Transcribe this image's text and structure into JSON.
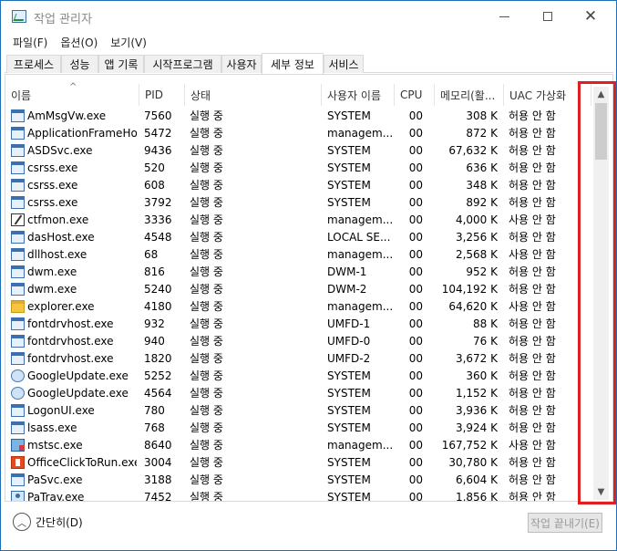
{
  "window": {
    "title": "작업 관리자",
    "icon": "task-manager-icon"
  },
  "menu": [
    "파일(F)",
    "옵션(O)",
    "보기(V)"
  ],
  "tabs": [
    {
      "label": "프로세스"
    },
    {
      "label": "성능"
    },
    {
      "label": "앱 기록"
    },
    {
      "label": "시작프로그램"
    },
    {
      "label": "사용자"
    },
    {
      "label": "세부 정보",
      "active": true
    },
    {
      "label": "서비스"
    }
  ],
  "columns": {
    "name": "이름",
    "pid": "PID",
    "status": "상태",
    "user": "사용자 이름",
    "cpu": "CPU",
    "memory": "메모리(활...",
    "uac": "UAC 가상화"
  },
  "processes": [
    {
      "name": "AmMsgVw.exe",
      "pid": "7560",
      "status": "실행 중",
      "user": "SYSTEM",
      "cpu": "00",
      "memory": "308 K",
      "uac": "허용 안 함",
      "icon": "app-icon"
    },
    {
      "name": "ApplicationFrameHo...",
      "pid": "5472",
      "status": "실행 중",
      "user": "managem...",
      "cpu": "00",
      "memory": "872 K",
      "uac": "허용 안 함",
      "icon": "window-icon"
    },
    {
      "name": "ASDSvc.exe",
      "pid": "9436",
      "status": "실행 중",
      "user": "SYSTEM",
      "cpu": "00",
      "memory": "67,632 K",
      "uac": "허용 안 함",
      "icon": "window-icon"
    },
    {
      "name": "csrss.exe",
      "pid": "520",
      "status": "실행 중",
      "user": "SYSTEM",
      "cpu": "00",
      "memory": "636 K",
      "uac": "허용 안 함",
      "icon": "window-icon"
    },
    {
      "name": "csrss.exe",
      "pid": "608",
      "status": "실행 중",
      "user": "SYSTEM",
      "cpu": "00",
      "memory": "348 K",
      "uac": "허용 안 함",
      "icon": "window-icon"
    },
    {
      "name": "csrss.exe",
      "pid": "3792",
      "status": "실행 중",
      "user": "SYSTEM",
      "cpu": "00",
      "memory": "892 K",
      "uac": "허용 안 함",
      "icon": "window-icon"
    },
    {
      "name": "ctfmon.exe",
      "pid": "3336",
      "status": "실행 중",
      "user": "managem...",
      "cpu": "00",
      "memory": "4,000 K",
      "uac": "사용 안 함",
      "icon": "pen-icon"
    },
    {
      "name": "dasHost.exe",
      "pid": "4548",
      "status": "실행 중",
      "user": "LOCAL SE...",
      "cpu": "00",
      "memory": "3,256 K",
      "uac": "허용 안 함",
      "icon": "window-icon"
    },
    {
      "name": "dllhost.exe",
      "pid": "68",
      "status": "실행 중",
      "user": "managem...",
      "cpu": "00",
      "memory": "2,568 K",
      "uac": "사용 안 함",
      "icon": "window-icon"
    },
    {
      "name": "dwm.exe",
      "pid": "816",
      "status": "실행 중",
      "user": "DWM-1",
      "cpu": "00",
      "memory": "952 K",
      "uac": "허용 안 함",
      "icon": "window-icon"
    },
    {
      "name": "dwm.exe",
      "pid": "5240",
      "status": "실행 중",
      "user": "DWM-2",
      "cpu": "00",
      "memory": "104,192 K",
      "uac": "허용 안 함",
      "icon": "window-icon"
    },
    {
      "name": "explorer.exe",
      "pid": "4180",
      "status": "실행 중",
      "user": "managem...",
      "cpu": "00",
      "memory": "64,620 K",
      "uac": "사용 안 함",
      "icon": "folder-icon"
    },
    {
      "name": "fontdrvhost.exe",
      "pid": "932",
      "status": "실행 중",
      "user": "UMFD-1",
      "cpu": "00",
      "memory": "88 K",
      "uac": "허용 안 함",
      "icon": "window-icon"
    },
    {
      "name": "fontdrvhost.exe",
      "pid": "940",
      "status": "실행 중",
      "user": "UMFD-0",
      "cpu": "00",
      "memory": "76 K",
      "uac": "허용 안 함",
      "icon": "window-icon"
    },
    {
      "name": "fontdrvhost.exe",
      "pid": "1820",
      "status": "실행 중",
      "user": "UMFD-2",
      "cpu": "00",
      "memory": "3,672 K",
      "uac": "허용 안 함",
      "icon": "window-icon"
    },
    {
      "name": "GoogleUpdate.exe",
      "pid": "5252",
      "status": "실행 중",
      "user": "SYSTEM",
      "cpu": "00",
      "memory": "360 K",
      "uac": "허용 안 함",
      "icon": "gear-icon"
    },
    {
      "name": "GoogleUpdate.exe",
      "pid": "4564",
      "status": "실행 중",
      "user": "SYSTEM",
      "cpu": "00",
      "memory": "1,152 K",
      "uac": "허용 안 함",
      "icon": "gear-icon"
    },
    {
      "name": "LogonUI.exe",
      "pid": "780",
      "status": "실행 중",
      "user": "SYSTEM",
      "cpu": "00",
      "memory": "3,936 K",
      "uac": "허용 안 함",
      "icon": "window-icon"
    },
    {
      "name": "lsass.exe",
      "pid": "768",
      "status": "실행 중",
      "user": "SYSTEM",
      "cpu": "00",
      "memory": "3,924 K",
      "uac": "허용 안 함",
      "icon": "window-icon"
    },
    {
      "name": "mstsc.exe",
      "pid": "8640",
      "status": "실행 중",
      "user": "managem...",
      "cpu": "00",
      "memory": "167,752 K",
      "uac": "사용 안 함",
      "icon": "remote-desktop-icon"
    },
    {
      "name": "OfficeClickToRun.exe",
      "pid": "3004",
      "status": "실행 중",
      "user": "SYSTEM",
      "cpu": "00",
      "memory": "30,780 K",
      "uac": "허용 안 함",
      "icon": "office-icon"
    },
    {
      "name": "PaSvc.exe",
      "pid": "3188",
      "status": "실행 중",
      "user": "SYSTEM",
      "cpu": "00",
      "memory": "6,604 K",
      "uac": "허용 안 함",
      "icon": "window-icon"
    },
    {
      "name": "PaTray.exe",
      "pid": "7452",
      "status": "실행 중",
      "user": "SYSTEM",
      "cpu": "00",
      "memory": "1,856 K",
      "uac": "허용 안 함",
      "icon": "user-icon"
    }
  ],
  "footer": {
    "collapse_label": "간단히(D)",
    "end_task_label": "작업 끝내기(E)"
  },
  "colors": {
    "highlight": "#e02020",
    "accent": "#1f6fb8"
  }
}
